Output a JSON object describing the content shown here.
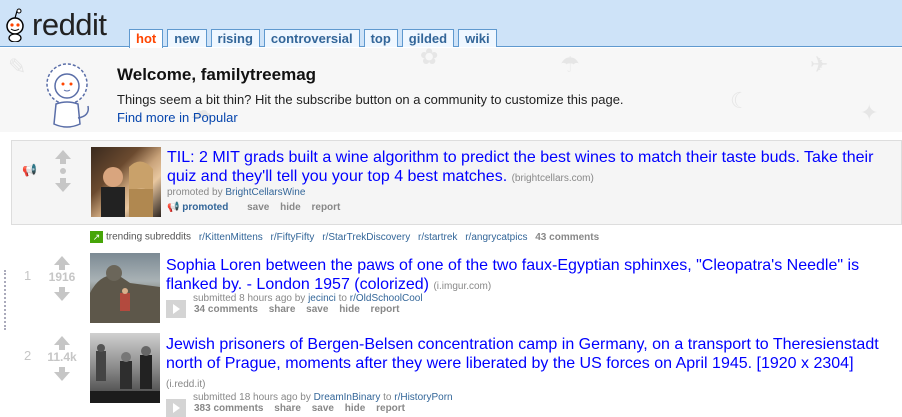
{
  "header": {
    "logo_text": "reddit",
    "tabs": [
      "hot",
      "new",
      "rising",
      "controversial",
      "top",
      "gilded",
      "wiki"
    ]
  },
  "welcome": {
    "title": "Welcome, familytreemag",
    "desc": "Things seem a bit thin? Hit the subscribe button on a community to customize this page.",
    "link": "Find more in Popular"
  },
  "promoted": {
    "title": "TIL: 2 MIT grads built a wine algorithm to predict the best wines to match their taste buds. Take their quiz and they'll tell you your top 4 best matches.",
    "domain": "(brightcellars.com)",
    "tagline_prefix": "promoted by ",
    "tagline_user": "BrightCellarsWine",
    "buttons": {
      "promoted": "promoted",
      "save": "save",
      "hide": "hide",
      "report": "report"
    }
  },
  "trending": {
    "label": "trending subreddits",
    "subs": [
      "r/KittenMittens",
      "r/FiftyFifty",
      "r/StarTrekDiscovery",
      "r/startrek",
      "r/angrycatpics"
    ],
    "comments": "43 comments"
  },
  "posts": [
    {
      "rank": "1",
      "score": "1916",
      "title": "Sophia Loren between the paws of one of the two faux-Egyptian sphinxes, \"Cleopatra's Needle\" is flanked by. - London 1957 (colorized)",
      "domain": "(i.imgur.com)",
      "submitted": "submitted 8 hours ago by ",
      "user": "jecinci",
      "to": " to ",
      "subreddit": "r/OldSchoolCool",
      "comments": "34 comments",
      "share": "share",
      "save": "save",
      "hide": "hide",
      "report": "report"
    },
    {
      "rank": "2",
      "score": "11.4k",
      "title": "Jewish prisoners of Bergen-Belsen concentration camp in Germany, on a transport to Theresienstadt north of Prague, moments after they were liberated by the US forces on April 1945. [1920 x 2304]",
      "domain": "(i.redd.it)",
      "submitted": "submitted 18 hours ago by ",
      "user": "DreamInBinary",
      "to": " to ",
      "subreddit": "r/HistoryPorn",
      "comments": "383 comments",
      "share": "share",
      "save": "save",
      "hide": "hide",
      "report": "report"
    }
  ],
  "colors": {
    "link": "#0000ff",
    "accent": "#ff4500",
    "header_bg": "#cee3f8"
  }
}
